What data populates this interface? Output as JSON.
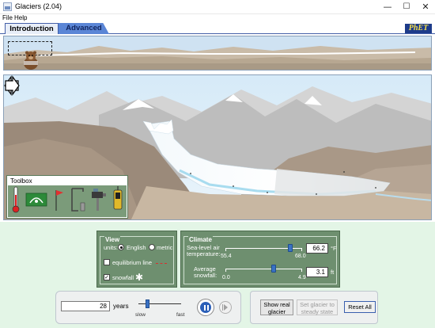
{
  "window": {
    "title": "Glaciers (2.04)",
    "minimize": "—",
    "maximize": "☐",
    "close": "✕"
  },
  "menu": [
    "File",
    "Help"
  ],
  "tabs": [
    {
      "label": "Introduction",
      "selected": true
    },
    {
      "label": "Advanced",
      "selected": false
    }
  ],
  "logo": "PhET",
  "toolbox": {
    "label": "Toolbox",
    "tools": [
      "thermometer-icon",
      "glacial-budget-meter-icon",
      "flag-icon",
      "borehole-drill-frame-icon",
      "ice-drill-icon",
      "gps-receiver-icon"
    ]
  },
  "view_panel": {
    "title": "View",
    "units_label": "units:",
    "unit_options": [
      {
        "label": "English",
        "selected": true
      },
      {
        "label": "metric",
        "selected": false
      }
    ],
    "equilibrium_line": {
      "label": "equilibrium line",
      "checked": false,
      "color": "#d83030"
    },
    "snowfall": {
      "label": "snowfall",
      "checked": true,
      "glyph": "✱"
    }
  },
  "climate_panel": {
    "title": "Climate",
    "temperature": {
      "label_line1": "Sea-level air",
      "label_line2": "temperature:",
      "min": "55.4",
      "max": "68.0",
      "value": "66.2",
      "unit": "°F",
      "slider_fraction": 0.857
    },
    "snowfall": {
      "label_line1": "Average",
      "label_line2": "snowfall:",
      "min": "0.0",
      "max": "4.9",
      "value": "3.1",
      "unit": "ft",
      "slider_fraction": 0.633
    }
  },
  "sim_controls": {
    "years_value": "28",
    "years_label": "years",
    "speed_slow": "slow",
    "speed_fast": "fast",
    "speed_fraction": 0.2
  },
  "buttons": {
    "show_real_glacier_line1": "Show real",
    "show_real_glacier_line2": "glacier",
    "set_steady_line1": "Set glacier to",
    "set_steady_line2": "steady state",
    "reset_all": "Reset All"
  },
  "colors": {
    "tab_selected": "#e8eef8",
    "tab_unselected": "#5b86d6",
    "panel_green": "#6e8f6f",
    "lower_bg": "#e3f5e6",
    "play_blue": "#2a5fb8"
  }
}
